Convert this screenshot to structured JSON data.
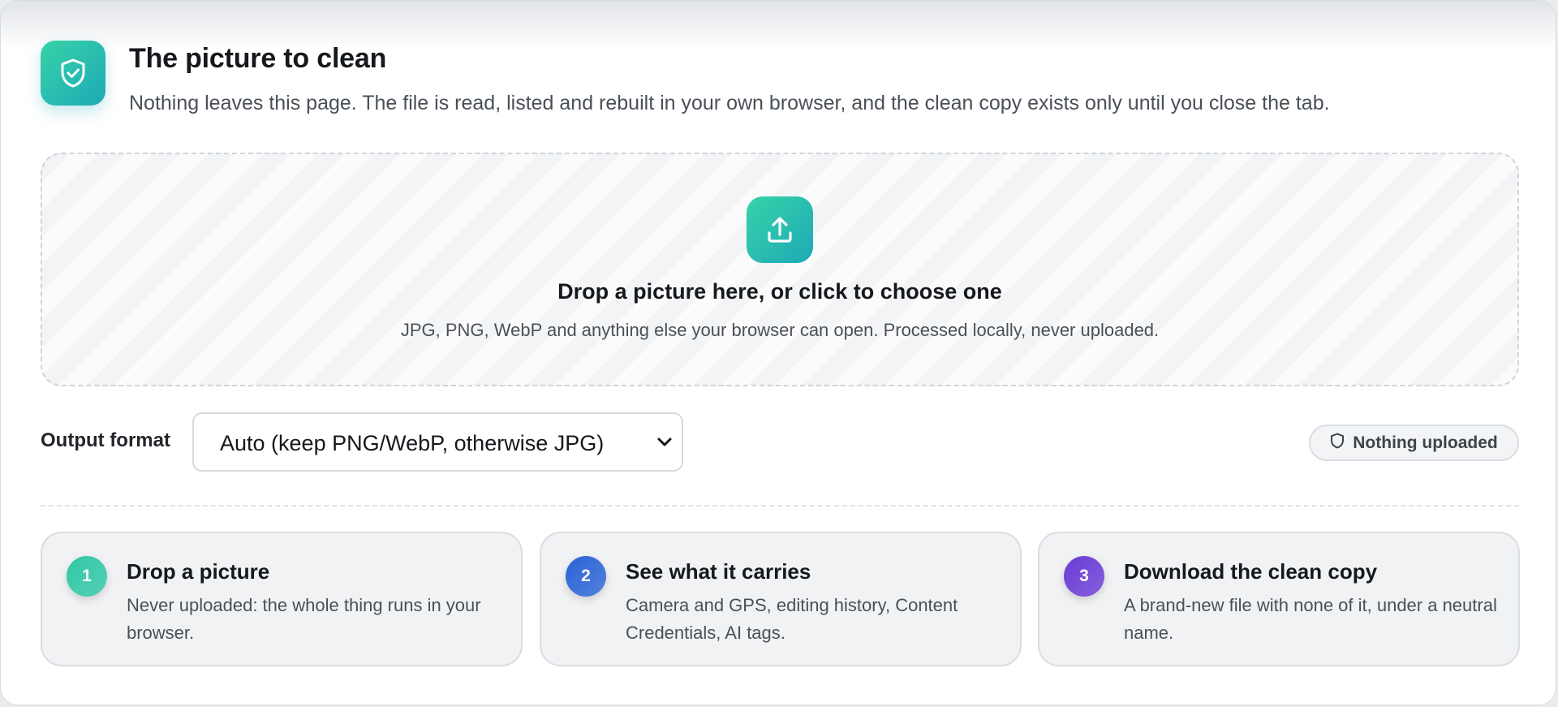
{
  "header": {
    "title": "The picture to clean",
    "subtitle": "Nothing leaves this page. The file is read, listed and rebuilt in your own browser, and the clean copy exists only until you close the tab.",
    "icon": "shield-check-icon"
  },
  "dropzone": {
    "icon": "upload-icon",
    "title": "Drop a picture here, or click to choose one",
    "subtitle": "JPG, PNG, WebP and anything else your browser can open. Processed locally, never uploaded."
  },
  "output": {
    "label": "Output format",
    "selected": "Auto (keep PNG/WebP, otherwise JPG)"
  },
  "badge": {
    "icon": "shield-icon",
    "label": "Nothing uploaded"
  },
  "steps": [
    {
      "number": "1",
      "title": "Drop a picture",
      "description": "Never uploaded: the whole thing runs in your browser.",
      "color": "#2fc7a6"
    },
    {
      "number": "2",
      "title": "See what it carries",
      "description": "Camera and GPS, editing history, Content Credentials, AI tags.",
      "color": "#2a63d6"
    },
    {
      "number": "3",
      "title": "Download the clean copy",
      "description": "A brand-new file with none of it, under a neutral name.",
      "color": "#6a3bd6"
    }
  ],
  "colors": {
    "accent": "#1ea9b6",
    "accent_light": "#37d3a8"
  }
}
